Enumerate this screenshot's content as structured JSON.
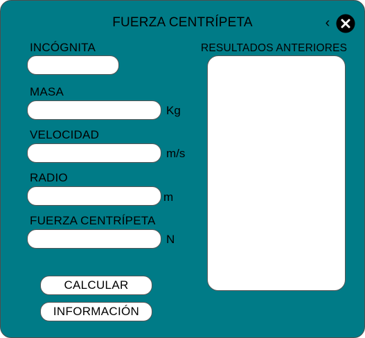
{
  "window": {
    "title": "FUERZA CENTRÍPETA",
    "background_color": "#007b87"
  },
  "header": {
    "back_icon": "chevron-left-icon",
    "back_glyph": "‹",
    "close_icon": "close-circle-icon"
  },
  "form": {
    "incognita": {
      "label": "INCÓGNITA",
      "value": ""
    },
    "masa": {
      "label": "MASA",
      "value": "",
      "unit": "Kg"
    },
    "velocidad": {
      "label": "VELOCIDAD",
      "value": "",
      "unit": "m/s"
    },
    "radio": {
      "label": "RADIO",
      "value": "",
      "unit": "m"
    },
    "fuerza": {
      "label": "FUERZA CENTRÍPETA",
      "value": "",
      "unit": "N"
    }
  },
  "results": {
    "label": "RESULTADOS ANTERIORES",
    "entries": []
  },
  "buttons": {
    "calcular": "CALCULAR",
    "informacion": "INFORMACIÓN"
  }
}
